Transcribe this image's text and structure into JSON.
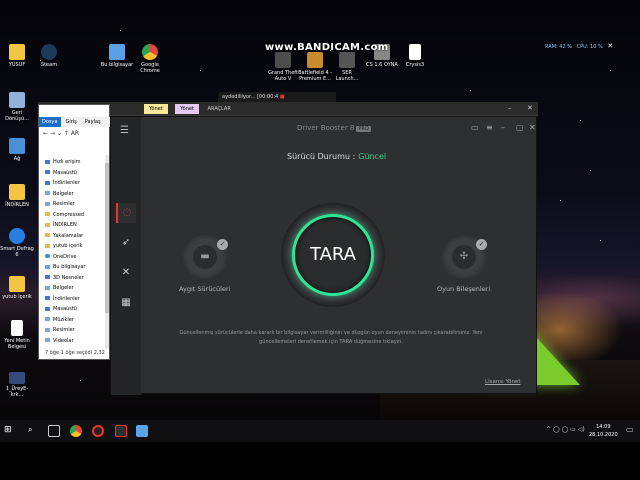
{
  "overlay": {
    "bandicam": "www.BANDICAM.com",
    "recorder": {
      "ram": "RAM: 42 %",
      "cpu": "CPU: 10 %"
    }
  },
  "recording_strip": {
    "file": "aydedilliyor...",
    "time": "[00:00:4"
  },
  "desktop_icons": [
    {
      "label": "YUSUF",
      "color": "#f4c542"
    },
    {
      "label": "Steam",
      "color": "#1b3a5c"
    },
    {
      "label": "Geri Dönüşü...",
      "color": "#8fb3d9"
    },
    {
      "label": "Ağ",
      "color": "#4a90d9"
    },
    {
      "label": "İNDİRLEN",
      "color": "#f4c542"
    },
    {
      "label": "Smart Defrag 6",
      "color": "#2a7de1"
    },
    {
      "label": "yutub içerik",
      "color": "#f4c542"
    },
    {
      "label": "Yeni Metin Belgesi",
      "color": "#ffffff"
    },
    {
      "label": "1_ÜreyE-krk...",
      "color": "#334a7a"
    },
    {
      "label": "Bu bilgisayar",
      "color": "#5aa0e6"
    },
    {
      "label": "Google Chrome",
      "color": "#e8453c"
    },
    {
      "label": "Grand Theft Auto V",
      "color": "#4d4d4d"
    },
    {
      "label": "Battlefield 4 - Premium E...",
      "color": "#c98b2d"
    },
    {
      "label": "SER Launch...",
      "color": "#555555"
    },
    {
      "label": "CS 1.6 OYNA",
      "color": "#888888"
    },
    {
      "label": "Crysis3",
      "color": "#ffffff"
    }
  ],
  "explorer": {
    "tabs": [
      "Dosya",
      "Giriş",
      "Paylaş"
    ],
    "toolbar_tabs": {
      "manage1": "Yönet",
      "manage2": "Yönet",
      "tools": "ARAÇLAR"
    },
    "path": "AR",
    "nav_items": [
      {
        "label": "Hızlı erişim",
        "type": "star"
      },
      {
        "label": "Masaüstü",
        "type": "blue"
      },
      {
        "label": "İndirilenler",
        "type": "blue"
      },
      {
        "label": "Belgeler",
        "type": "plain"
      },
      {
        "label": "Resimler",
        "type": "plain"
      },
      {
        "label": "Compressed",
        "type": "folder"
      },
      {
        "label": "İNDİRLEN",
        "type": "folder"
      },
      {
        "label": "Yakalamalar",
        "type": "folder"
      },
      {
        "label": "yutub içerik",
        "type": "folder"
      },
      {
        "label": "OneDrive",
        "type": "cloud"
      },
      {
        "label": "Bu bilgisayar",
        "type": "pc"
      },
      {
        "label": "3D Nesneler",
        "type": "blue"
      },
      {
        "label": "Belgeler",
        "type": "plain"
      },
      {
        "label": "İndirilenler",
        "type": "blue"
      },
      {
        "label": "Masaüstü",
        "type": "blue"
      },
      {
        "label": "Müzikler",
        "type": "plain"
      },
      {
        "label": "Resimler",
        "type": "plain"
      },
      {
        "label": "Videolar",
        "type": "plain"
      }
    ],
    "status": "7 öğe   1 öğe seçildi  2,32"
  },
  "driver_booster": {
    "title": "Driver Booster 8",
    "badge": "PRO",
    "status_label": "Sürücü Durumu :",
    "status_value": "Güncel",
    "scan_button": "TARA",
    "device_drivers": "Aygıt Sürücüleri",
    "game_components": "Oyun Bileşenleri",
    "description": "Güncellenmiş sürücülerle daha kararlı bir bilgisayar verimliliğinin ve düzgün oyun deneyiminin tadını çıkarabilirsiniz. Yeni güncellemeleri denetlemek için TARA düğmesine tıklayın.",
    "license": "Lisansı Yönet",
    "accent": "#2fe39a"
  },
  "taskbar": {
    "tray": "^ ◯ ◯ ▭ ◁)",
    "time": "14:09",
    "date": "28.10.2020"
  }
}
